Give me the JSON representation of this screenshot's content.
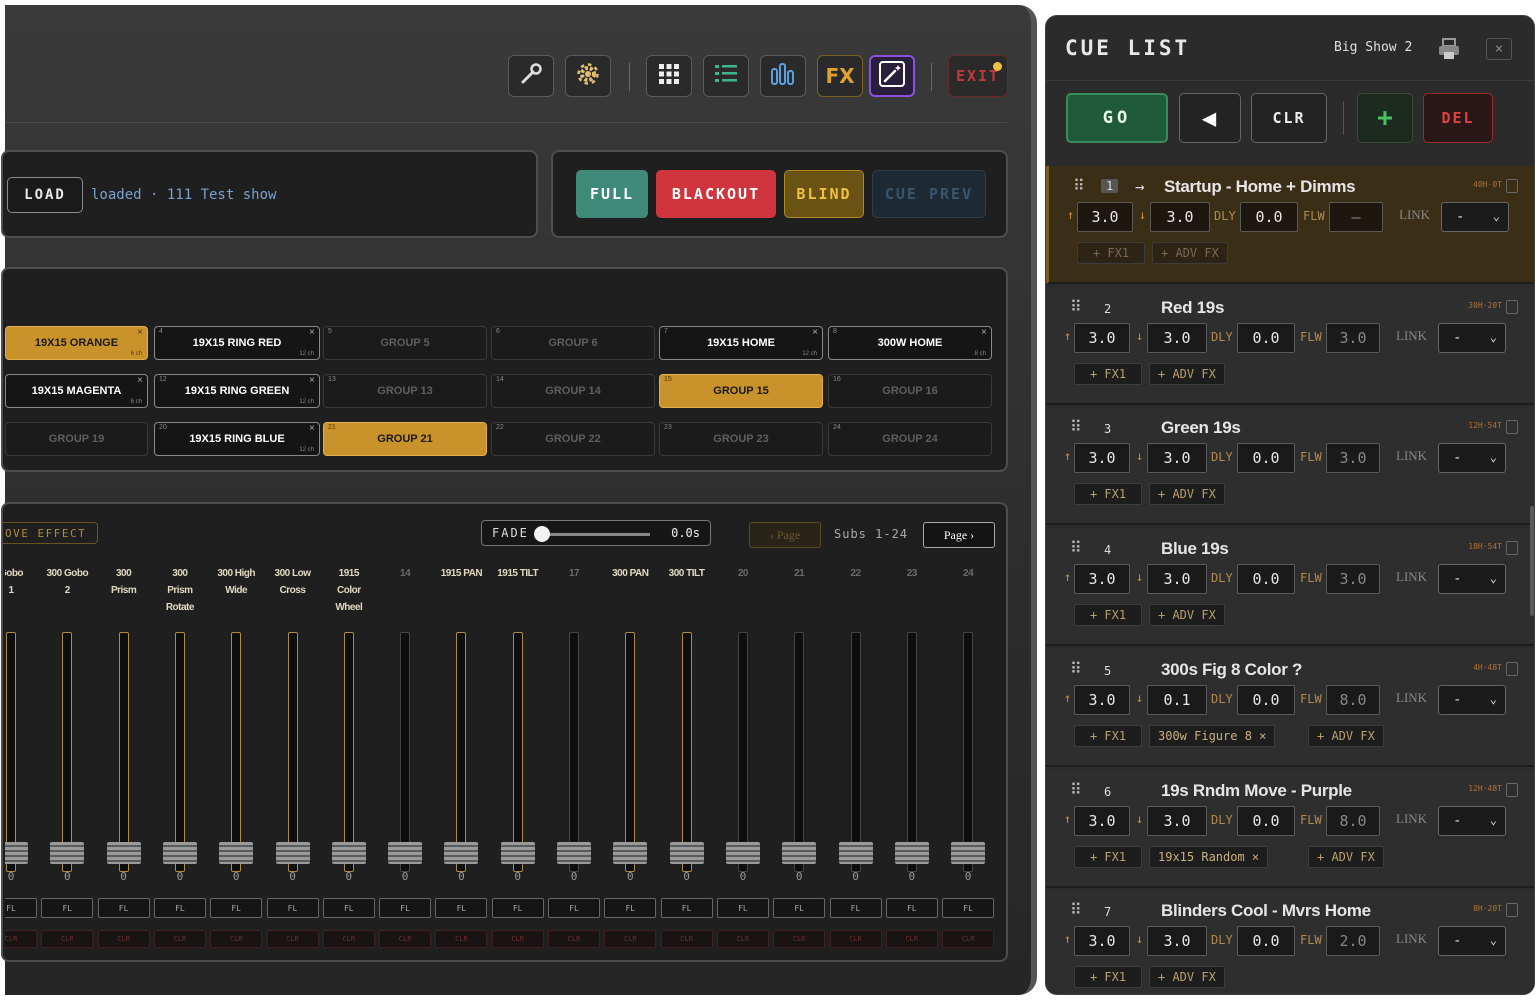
{
  "toolbar": {
    "icons": [
      "wrench-icon",
      "gear-icon",
      "grid-icon",
      "list-icon",
      "faders-icon",
      "fx-icon",
      "magic-icon"
    ],
    "fx_label": "FX",
    "exit_label": "EXIT"
  },
  "show": {
    "load_label": "LOAD",
    "status_text": "loaded · 111 Test show"
  },
  "master_buttons": {
    "full": "FULL",
    "blackout": "BLACKOUT",
    "blind": "BLIND",
    "cue_prev": "CUE PREV"
  },
  "groups": [
    {
      "num": "",
      "label": "19X15 ORANGE",
      "ch": "6 ch",
      "state": "selected"
    },
    {
      "num": "4",
      "label": "19X15 RING RED",
      "ch": "12 ch",
      "state": "assigned"
    },
    {
      "num": "5",
      "label": "GROUP 5",
      "ch": "",
      "state": "empty"
    },
    {
      "num": "6",
      "label": "GROUP 6",
      "ch": "",
      "state": "empty"
    },
    {
      "num": "7",
      "label": "19X15 HOME",
      "ch": "12 ch",
      "state": "assigned"
    },
    {
      "num": "8",
      "label": "300W HOME",
      "ch": "8 ch",
      "state": "assigned"
    },
    {
      "num": "",
      "label": "19X15 MAGENTA",
      "ch": "6 ch",
      "state": "assigned"
    },
    {
      "num": "12",
      "label": "19X15 RING GREEN",
      "ch": "12 ch",
      "state": "assigned"
    },
    {
      "num": "13",
      "label": "GROUP 13",
      "ch": "",
      "state": "empty"
    },
    {
      "num": "14",
      "label": "GROUP 14",
      "ch": "",
      "state": "empty"
    },
    {
      "num": "15",
      "label": "GROUP 15",
      "ch": "",
      "state": "selected"
    },
    {
      "num": "16",
      "label": "GROUP 16",
      "ch": "",
      "state": "empty"
    },
    {
      "num": "",
      "label": "GROUP 19",
      "ch": "",
      "state": "empty"
    },
    {
      "num": "20",
      "label": "19X15 RING BLUE",
      "ch": "12 ch",
      "state": "assigned"
    },
    {
      "num": "21",
      "label": "GROUP 21",
      "ch": "",
      "state": "selected"
    },
    {
      "num": "22",
      "label": "GROUP 22",
      "ch": "",
      "state": "empty"
    },
    {
      "num": "23",
      "label": "GROUP 23",
      "ch": "",
      "state": "empty"
    },
    {
      "num": "24",
      "label": "GROUP 24",
      "ch": "",
      "state": "empty"
    }
  ],
  "faders": {
    "effect_label": "OVE EFFECT",
    "fade_label": "FADE",
    "fade_value": "0.0s",
    "fade_level": 0.0,
    "page_prev": "‹ Page",
    "subs_label": "Subs 1-24",
    "page_next": "Page ›",
    "channels": [
      {
        "l1": "",
        "l2": "Gobo",
        "l3": "1",
        "active": true
      },
      {
        "l1": "",
        "l2": "300 Gobo",
        "l3": "2",
        "active": true
      },
      {
        "l1": "",
        "l2": "300",
        "l3": "Prism",
        "active": true
      },
      {
        "l1": "300",
        "l2": "Prism",
        "l3": "Rotate",
        "active": true
      },
      {
        "l1": "",
        "l2": "300 High",
        "l3": "Wide",
        "active": true
      },
      {
        "l1": "",
        "l2": "300 Low",
        "l3": "Cross",
        "active": true
      },
      {
        "l1": "1915",
        "l2": "Color",
        "l3": "Wheel",
        "active": true
      },
      {
        "l1": "",
        "l2": "",
        "l3": "14",
        "active": false
      },
      {
        "l1": "",
        "l2": "",
        "l3": "1915 PAN",
        "active": true
      },
      {
        "l1": "",
        "l2": "",
        "l3": "1915 TILT",
        "active": true
      },
      {
        "l1": "",
        "l2": "",
        "l3": "17",
        "active": false
      },
      {
        "l1": "",
        "l2": "",
        "l3": "300 PAN",
        "active": true
      },
      {
        "l1": "",
        "l2": "",
        "l3": "300 TILT",
        "active": true
      },
      {
        "l1": "",
        "l2": "",
        "l3": "20",
        "active": false
      },
      {
        "l1": "",
        "l2": "",
        "l3": "21",
        "active": false
      },
      {
        "l1": "",
        "l2": "",
        "l3": "22",
        "active": false
      },
      {
        "l1": "",
        "l2": "",
        "l3": "23",
        "active": false
      },
      {
        "l1": "",
        "l2": "",
        "l3": "24",
        "active": false
      }
    ],
    "value": "0",
    "fl_label": "FL",
    "clr_label": "CLR"
  },
  "cue_list": {
    "title": "CUE LIST",
    "show_name": "Big Show 2",
    "close": "×",
    "go": "GO",
    "back": "◀",
    "clr": "CLR",
    "add": "+",
    "del": "DEL",
    "dly": "DLY",
    "flw": "FLW",
    "link": "LINK",
    "fx1": "+ FX1",
    "adv_fx": "+ ADV FX",
    "cues": [
      {
        "num": "1",
        "name": "Startup - Home + Dimms",
        "meta": "40H·0T",
        "up": "3.0",
        "down": "3.0",
        "dly": "0.0",
        "flw": "–",
        "link": "-",
        "extra": "",
        "current": true
      },
      {
        "num": "2",
        "name": "Red 19s",
        "meta": "30H·20T",
        "up": "3.0",
        "down": "3.0",
        "dly": "0.0",
        "flw": "3.0",
        "link": "-",
        "extra": "",
        "current": false
      },
      {
        "num": "3",
        "name": "Green 19s",
        "meta": "12H·54T",
        "up": "3.0",
        "down": "3.0",
        "dly": "0.0",
        "flw": "3.0",
        "link": "-",
        "extra": "",
        "current": false
      },
      {
        "num": "4",
        "name": "Blue 19s",
        "meta": "18H·54T",
        "up": "3.0",
        "down": "3.0",
        "dly": "0.0",
        "flw": "3.0",
        "link": "-",
        "extra": "",
        "current": false
      },
      {
        "num": "5",
        "name": "300s Fig 8 Color ?",
        "meta": "4H·48T",
        "up": "3.0",
        "down": "0.1",
        "dly": "0.0",
        "flw": "8.0",
        "link": "-",
        "extra": "300w Figure 8 ×",
        "current": false
      },
      {
        "num": "6",
        "name": "19s Rndm Move - Purple",
        "meta": "12H·48T",
        "up": "3.0",
        "down": "3.0",
        "dly": "0.0",
        "flw": "8.0",
        "link": "-",
        "extra": "19x15 Random ×",
        "current": false
      },
      {
        "num": "7",
        "name": "Blinders Cool - Mvrs Home",
        "meta": "8H·20T",
        "up": "3.0",
        "down": "3.0",
        "dly": "0.0",
        "flw": "2.0",
        "link": "-",
        "extra": "",
        "current": false
      }
    ]
  },
  "colors": {
    "full": "#3f8a78",
    "blackout": "#d0343c",
    "blind": "#6a5215",
    "cue_prev": "#1e2a33",
    "go": "#1f5a3a",
    "accent": "#c9922a"
  }
}
